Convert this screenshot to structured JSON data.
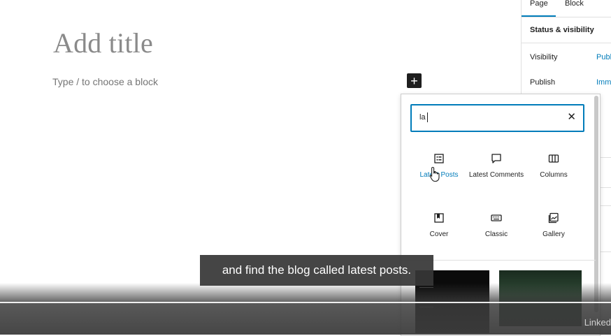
{
  "editor": {
    "title_placeholder": "Add title",
    "block_placeholder": "Type / to choose a block",
    "add_block_symbol": "+"
  },
  "sidebar": {
    "tabs": [
      {
        "label": "Page",
        "active": true
      },
      {
        "label": "Block",
        "active": false
      }
    ],
    "panel_title": "Status & visibility",
    "rows": [
      {
        "label": "Visibility",
        "value": "Publi"
      },
      {
        "label": "Publish",
        "value": "Imme"
      }
    ]
  },
  "inserter": {
    "search_value": "la",
    "clear_symbol": "✕",
    "blocks": [
      {
        "label": "Latest Posts",
        "icon": "list-icon",
        "selected": true
      },
      {
        "label": "Latest Comments",
        "icon": "comment-icon",
        "selected": false
      },
      {
        "label": "Columns",
        "icon": "columns-icon",
        "selected": false
      },
      {
        "label": "Cover",
        "icon": "cover-icon",
        "selected": false
      },
      {
        "label": "Classic",
        "icon": "keyboard-icon",
        "selected": false
      },
      {
        "label": "Gallery",
        "icon": "gallery-icon",
        "selected": false
      }
    ],
    "patterns": [
      "dark-pattern",
      "forest-pattern"
    ]
  },
  "video": {
    "caption": "and find the blog called latest posts.",
    "watermark": "Linked"
  },
  "colors": {
    "accent": "#007cba",
    "text": "#1e1e1e",
    "caption_bg": "#373737"
  }
}
